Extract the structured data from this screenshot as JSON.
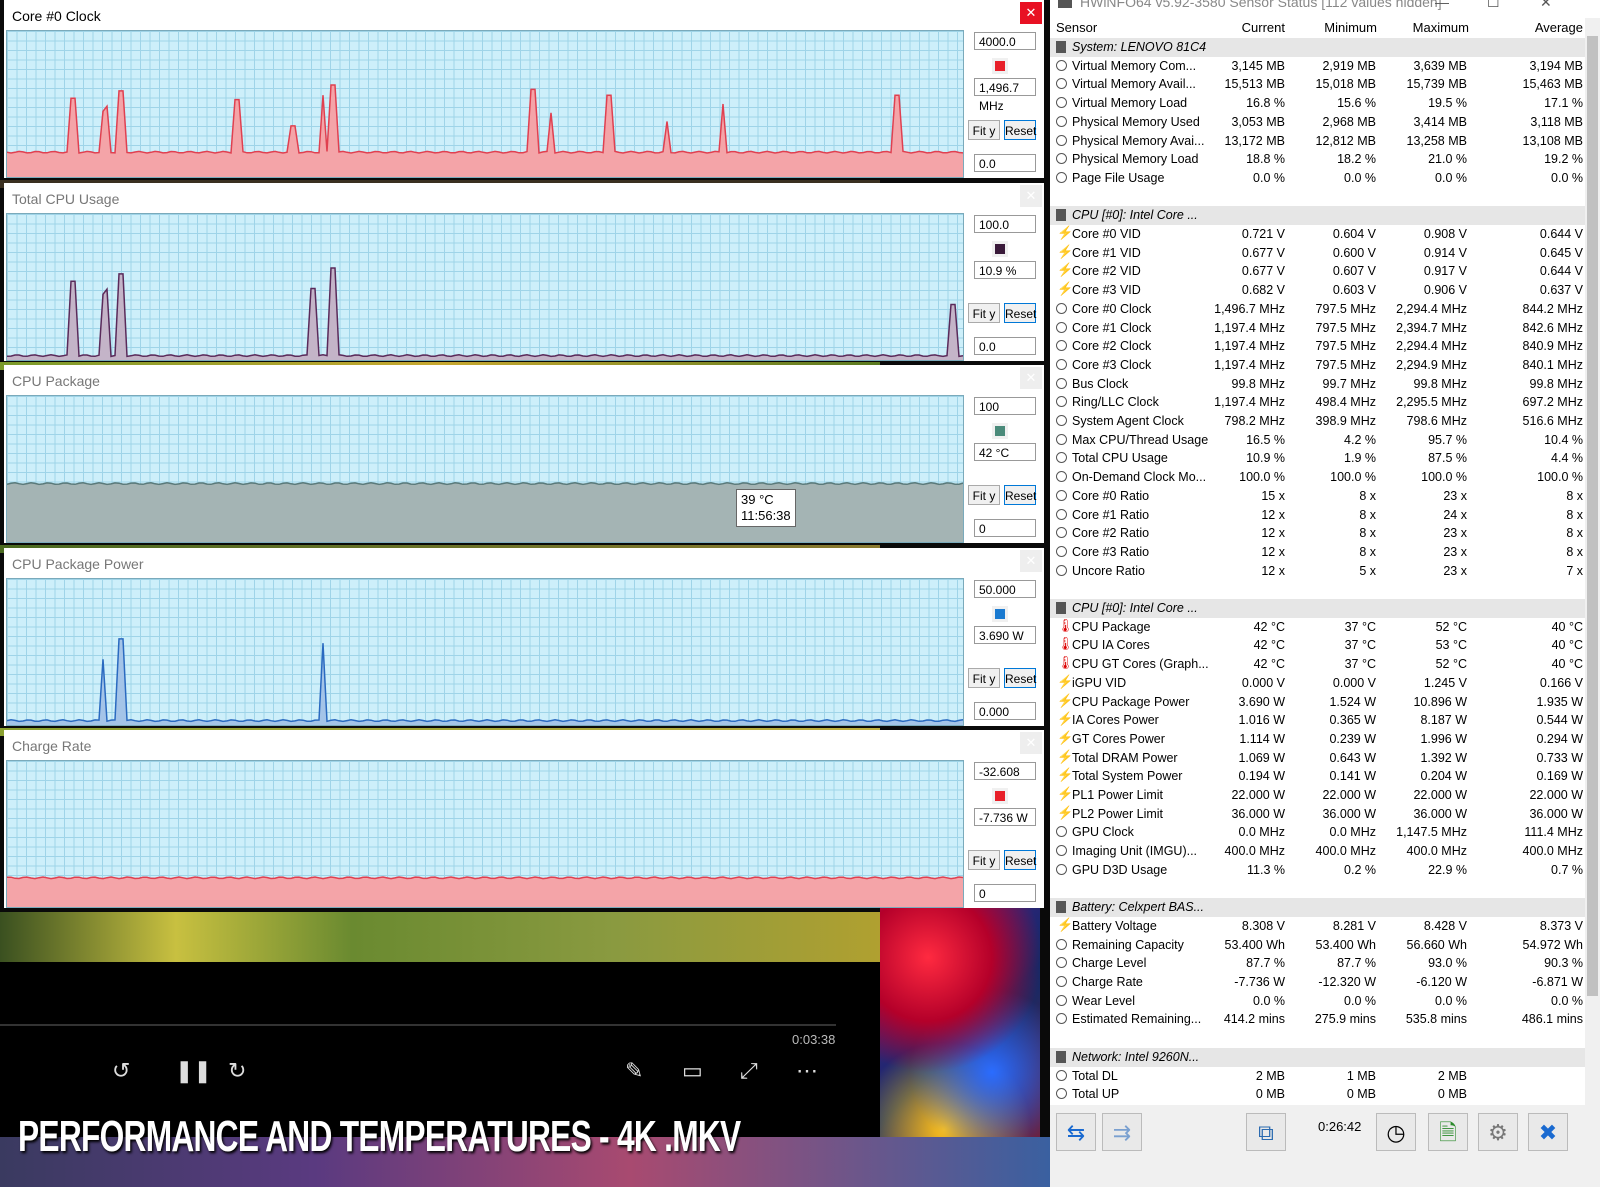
{
  "graphs": [
    {
      "title": "Core #0 Clock",
      "top_value": "4000.0",
      "current": "1,496.7 MHz",
      "bottom_value": "0.0",
      "fit_label": "Fit y",
      "reset_label": "Reset",
      "swatch": "#e8202a",
      "line": "#e04050",
      "fill": "#f4a4a8",
      "level": 0.17,
      "spikes": [
        0.07,
        0.1,
        0.105,
        0.12,
        0.24,
        0.3,
        0.33,
        0.34,
        0.55,
        0.57,
        0.63,
        0.69,
        0.75,
        0.93
      ]
    },
    {
      "title": "Total CPU Usage",
      "top_value": "100.0",
      "current": "10.9 %",
      "bottom_value": "0.0",
      "fit_label": "Fit y",
      "reset_label": "Reset",
      "swatch": "#3a1a3a",
      "line": "#5a2a5a",
      "fill": "#c4b4c8",
      "level": 0.03,
      "spikes": [
        0.07,
        0.1,
        0.105,
        0.12,
        0.32,
        0.34,
        0.99
      ]
    },
    {
      "title": "CPU Package",
      "top_value": "100",
      "current": "42 °C",
      "bottom_value": "0",
      "fit_label": "Fit y",
      "reset_label": "Reset",
      "swatch": "#4a8a7a",
      "line": "#5a7a7a",
      "fill": "#a4b4b4",
      "level": 0.4,
      "spikes": [],
      "tooltip": [
        "39 °C",
        "11:56:38"
      ]
    },
    {
      "title": "CPU Package Power",
      "top_value": "50.000",
      "current": "3.690 W",
      "bottom_value": "0.000",
      "fit_label": "Fit y",
      "reset_label": "Reset",
      "swatch": "#1a7ad0",
      "line": "#2a6ac0",
      "fill": "#a4c4e8",
      "level": 0.03,
      "spikes": [
        0.1,
        0.12,
        0.33
      ]
    },
    {
      "title": "Charge Rate",
      "top_value": "-32.608",
      "current": "-7.736 W",
      "bottom_value": "0",
      "fit_label": "Fit y",
      "reset_label": "Reset",
      "swatch": "#e8202a",
      "line": "#e04050",
      "fill": "#f4a4a8",
      "level": 0.2,
      "spikes": []
    }
  ],
  "hwinfo": {
    "title": "HWiNFO64 v5.92-3580 Sensor Status [112 values hidden]",
    "columns": [
      "Sensor",
      "Current",
      "Minimum",
      "Maximum",
      "Average"
    ],
    "rows": [
      {
        "type": "group",
        "label": "System: LENOVO 81C4"
      },
      {
        "icon": "clock",
        "label": "Virtual Memory Com...",
        "cur": "3,145 MB",
        "min": "2,919 MB",
        "max": "3,639 MB",
        "avg": "3,194 MB"
      },
      {
        "icon": "clock",
        "label": "Virtual Memory Avail...",
        "cur": "15,513 MB",
        "min": "15,018 MB",
        "max": "15,739 MB",
        "avg": "15,463 MB"
      },
      {
        "icon": "clock",
        "label": "Virtual Memory Load",
        "cur": "16.8 %",
        "min": "15.6 %",
        "max": "19.5 %",
        "avg": "17.1 %"
      },
      {
        "icon": "clock",
        "label": "Physical Memory Used",
        "cur": "3,053 MB",
        "min": "2,968 MB",
        "max": "3,414 MB",
        "avg": "3,118 MB"
      },
      {
        "icon": "clock",
        "label": "Physical Memory Avai...",
        "cur": "13,172 MB",
        "min": "12,812 MB",
        "max": "13,258 MB",
        "avg": "13,108 MB"
      },
      {
        "icon": "clock",
        "label": "Physical Memory Load",
        "cur": "18.8 %",
        "min": "18.2 %",
        "max": "21.0 %",
        "avg": "19.2 %"
      },
      {
        "icon": "clock",
        "label": "Page File Usage",
        "cur": "0.0 %",
        "min": "0.0 %",
        "max": "0.0 %",
        "avg": "0.0 %"
      },
      {
        "type": "blank"
      },
      {
        "type": "group",
        "label": "CPU [#0]: Intel Core ..."
      },
      {
        "icon": "volt",
        "label": "Core #0 VID",
        "cur": "0.721 V",
        "min": "0.604 V",
        "max": "0.908 V",
        "avg": "0.644 V"
      },
      {
        "icon": "volt",
        "label": "Core #1 VID",
        "cur": "0.677 V",
        "min": "0.600 V",
        "max": "0.914 V",
        "avg": "0.645 V"
      },
      {
        "icon": "volt",
        "label": "Core #2 VID",
        "cur": "0.677 V",
        "min": "0.607 V",
        "max": "0.917 V",
        "avg": "0.644 V"
      },
      {
        "icon": "volt",
        "label": "Core #3 VID",
        "cur": "0.682 V",
        "min": "0.603 V",
        "max": "0.906 V",
        "avg": "0.637 V"
      },
      {
        "icon": "clock",
        "label": "Core #0 Clock",
        "cur": "1,496.7 MHz",
        "min": "797.5 MHz",
        "max": "2,294.4 MHz",
        "avg": "844.2 MHz"
      },
      {
        "icon": "clock",
        "label": "Core #1 Clock",
        "cur": "1,197.4 MHz",
        "min": "797.5 MHz",
        "max": "2,394.7 MHz",
        "avg": "842.6 MHz"
      },
      {
        "icon": "clock",
        "label": "Core #2 Clock",
        "cur": "1,197.4 MHz",
        "min": "797.5 MHz",
        "max": "2,294.4 MHz",
        "avg": "840.9 MHz"
      },
      {
        "icon": "clock",
        "label": "Core #3 Clock",
        "cur": "1,197.4 MHz",
        "min": "797.5 MHz",
        "max": "2,294.9 MHz",
        "avg": "840.1 MHz"
      },
      {
        "icon": "clock",
        "label": "Bus Clock",
        "cur": "99.8 MHz",
        "min": "99.7 MHz",
        "max": "99.8 MHz",
        "avg": "99.8 MHz"
      },
      {
        "icon": "clock",
        "label": "Ring/LLC Clock",
        "cur": "1,197.4 MHz",
        "min": "498.4 MHz",
        "max": "2,295.5 MHz",
        "avg": "697.2 MHz"
      },
      {
        "icon": "clock",
        "label": "System Agent Clock",
        "cur": "798.2 MHz",
        "min": "398.9 MHz",
        "max": "798.6 MHz",
        "avg": "516.6 MHz"
      },
      {
        "icon": "clock",
        "label": "Max CPU/Thread Usage",
        "cur": "16.5 %",
        "min": "4.2 %",
        "max": "95.7 %",
        "avg": "10.4 %"
      },
      {
        "icon": "clock",
        "label": "Total CPU Usage",
        "cur": "10.9 %",
        "min": "1.9 %",
        "max": "87.5 %",
        "avg": "4.4 %"
      },
      {
        "icon": "clock",
        "label": "On-Demand Clock Mo...",
        "cur": "100.0 %",
        "min": "100.0 %",
        "max": "100.0 %",
        "avg": "100.0 %"
      },
      {
        "icon": "clock",
        "label": "Core #0 Ratio",
        "cur": "15 x",
        "min": "8 x",
        "max": "23 x",
        "avg": "8 x"
      },
      {
        "icon": "clock",
        "label": "Core #1 Ratio",
        "cur": "12 x",
        "min": "8 x",
        "max": "24 x",
        "avg": "8 x"
      },
      {
        "icon": "clock",
        "label": "Core #2 Ratio",
        "cur": "12 x",
        "min": "8 x",
        "max": "23 x",
        "avg": "8 x"
      },
      {
        "icon": "clock",
        "label": "Core #3 Ratio",
        "cur": "12 x",
        "min": "8 x",
        "max": "23 x",
        "avg": "8 x"
      },
      {
        "icon": "clock",
        "label": "Uncore Ratio",
        "cur": "12 x",
        "min": "5 x",
        "max": "23 x",
        "avg": "7 x"
      },
      {
        "type": "blank"
      },
      {
        "type": "group",
        "label": "CPU [#0]: Intel Core ..."
      },
      {
        "icon": "temp",
        "label": "CPU Package",
        "cur": "42 °C",
        "min": "37 °C",
        "max": "52 °C",
        "avg": "40 °C"
      },
      {
        "icon": "temp",
        "label": "CPU IA Cores",
        "cur": "42 °C",
        "min": "37 °C",
        "max": "53 °C",
        "avg": "40 °C"
      },
      {
        "icon": "temp",
        "label": "CPU GT Cores (Graph...",
        "cur": "42 °C",
        "min": "37 °C",
        "max": "52 °C",
        "avg": "40 °C"
      },
      {
        "icon": "volt",
        "label": "iGPU VID",
        "cur": "0.000 V",
        "min": "0.000 V",
        "max": "1.245 V",
        "avg": "0.166 V"
      },
      {
        "icon": "volt",
        "label": "CPU Package Power",
        "cur": "3.690 W",
        "min": "1.524 W",
        "max": "10.896 W",
        "avg": "1.935 W"
      },
      {
        "icon": "volt",
        "label": "IA Cores Power",
        "cur": "1.016 W",
        "min": "0.365 W",
        "max": "8.187 W",
        "avg": "0.544 W"
      },
      {
        "icon": "volt",
        "label": "GT Cores Power",
        "cur": "1.114 W",
        "min": "0.239 W",
        "max": "1.996 W",
        "avg": "0.294 W"
      },
      {
        "icon": "volt",
        "label": "Total DRAM Power",
        "cur": "1.069 W",
        "min": "0.643 W",
        "max": "1.392 W",
        "avg": "0.733 W"
      },
      {
        "icon": "volt",
        "label": "Total System Power",
        "cur": "0.194 W",
        "min": "0.141 W",
        "max": "0.204 W",
        "avg": "0.169 W"
      },
      {
        "icon": "volt",
        "label": "PL1 Power Limit",
        "cur": "22.000 W",
        "min": "22.000 W",
        "max": "22.000 W",
        "avg": "22.000 W"
      },
      {
        "icon": "volt",
        "label": "PL2 Power Limit",
        "cur": "36.000 W",
        "min": "36.000 W",
        "max": "36.000 W",
        "avg": "36.000 W"
      },
      {
        "icon": "clock",
        "label": "GPU Clock",
        "cur": "0.0 MHz",
        "min": "0.0 MHz",
        "max": "1,147.5 MHz",
        "avg": "111.4 MHz"
      },
      {
        "icon": "clock",
        "label": "Imaging Unit (IMGU)...",
        "cur": "400.0 MHz",
        "min": "400.0 MHz",
        "max": "400.0 MHz",
        "avg": "400.0 MHz"
      },
      {
        "icon": "clock",
        "label": "GPU D3D Usage",
        "cur": "11.3 %",
        "min": "0.2 %",
        "max": "22.9 %",
        "avg": "0.7 %"
      },
      {
        "type": "blank"
      },
      {
        "type": "group",
        "label": "Battery: Celxpert BAS..."
      },
      {
        "icon": "volt",
        "label": "Battery Voltage",
        "cur": "8.308 V",
        "min": "8.281 V",
        "max": "8.428 V",
        "avg": "8.373 V"
      },
      {
        "icon": "clock",
        "label": "Remaining Capacity",
        "cur": "53.400 Wh",
        "min": "53.400 Wh",
        "max": "56.660 Wh",
        "avg": "54.972 Wh"
      },
      {
        "icon": "clock",
        "label": "Charge Level",
        "cur": "87.7 %",
        "min": "87.7 %",
        "max": "93.0 %",
        "avg": "90.3 %"
      },
      {
        "icon": "clock",
        "label": "Charge Rate",
        "cur": "-7.736 W",
        "min": "-12.320 W",
        "max": "-6.120 W",
        "avg": "-6.871 W"
      },
      {
        "icon": "clock",
        "label": "Wear Level",
        "cur": "0.0 %",
        "min": "0.0 %",
        "max": "0.0 %",
        "avg": "0.0 %"
      },
      {
        "icon": "clock",
        "label": "Estimated Remaining...",
        "cur": "414.2 mins",
        "min": "275.9 mins",
        "max": "535.8 mins",
        "avg": "486.1 mins"
      },
      {
        "type": "blank"
      },
      {
        "type": "group",
        "label": "Network: Intel 9260N..."
      },
      {
        "icon": "clock",
        "label": "Total DL",
        "cur": "2 MB",
        "min": "1 MB",
        "max": "2 MB",
        "avg": ""
      },
      {
        "icon": "clock",
        "label": "Total UP",
        "cur": "0 MB",
        "min": "0 MB",
        "max": "0 MB",
        "avg": ""
      }
    ],
    "elapsed": "0:26:42"
  },
  "player": {
    "time": "0:03:38"
  },
  "overlay_title": "PERFORMANCE AND TEMPERATURES - 4K .MKV"
}
